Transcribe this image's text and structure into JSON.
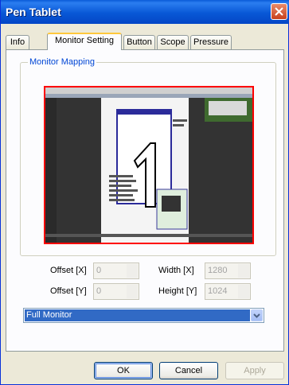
{
  "window": {
    "title": "Pen Tablet"
  },
  "tabs": [
    {
      "label": "Info"
    },
    {
      "label": "Monitor Setting"
    },
    {
      "label": "Button"
    },
    {
      "label": "Scope"
    },
    {
      "label": "Pressure"
    }
  ],
  "group": {
    "label": "Monitor Mapping"
  },
  "fields": {
    "offset_x": {
      "label": "Offset [X]",
      "value": "0"
    },
    "offset_y": {
      "label": "Offset [Y]",
      "value": "0"
    },
    "width_x": {
      "label": "Width [X]",
      "value": "1280"
    },
    "height_y": {
      "label": "Height [Y]",
      "value": "1024"
    }
  },
  "monitor_select": {
    "selected": "Full Monitor"
  },
  "buttons": {
    "ok": "OK",
    "cancel": "Cancel",
    "apply": "Apply"
  },
  "colors": {
    "titlebar": "#0858d6",
    "mapping_border": "#ff0000",
    "selection": "#316ac5",
    "tab_highlight": "#ffc83c"
  }
}
